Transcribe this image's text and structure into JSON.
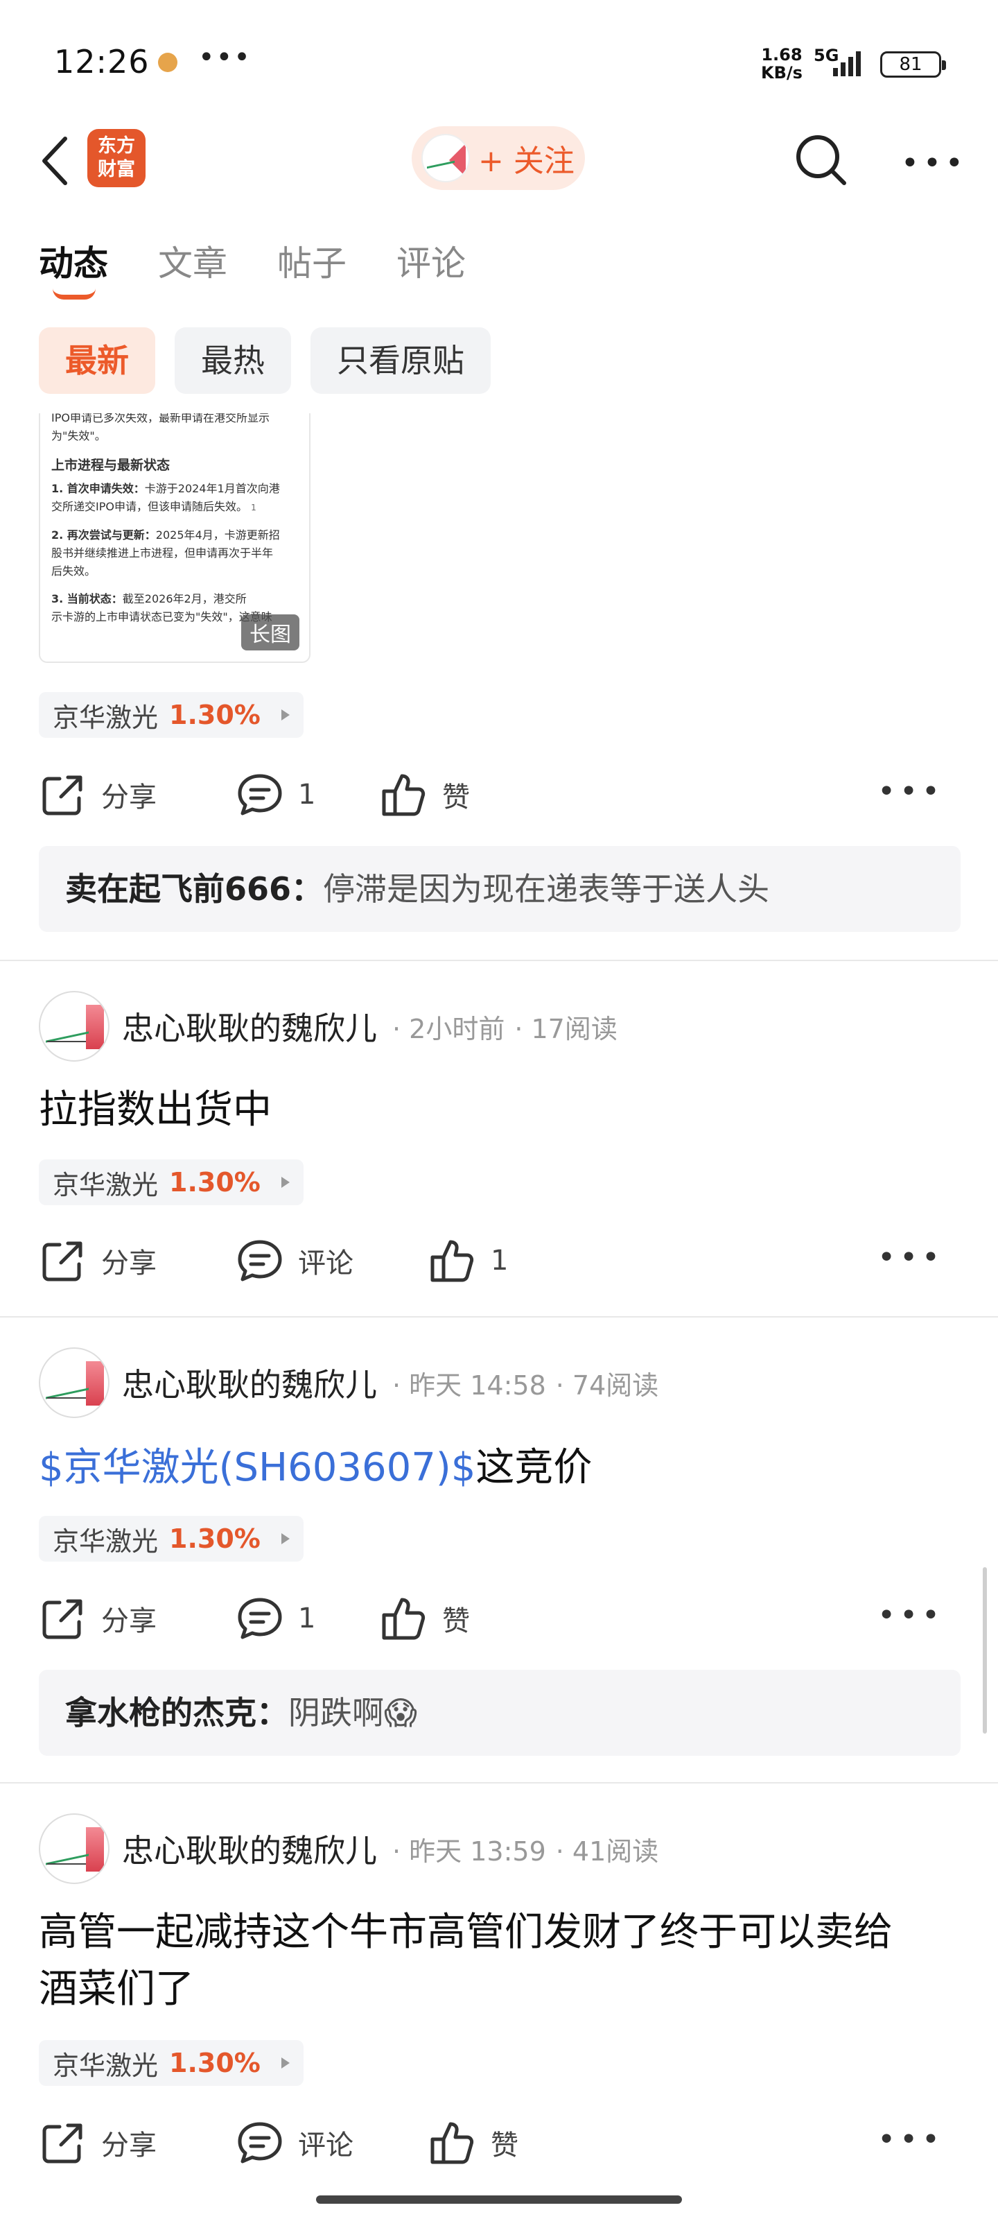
{
  "status_bar": {
    "time": "12:26",
    "speed_value": "1.68",
    "speed_unit": "KB/s",
    "network": "5G",
    "battery": "81"
  },
  "nav": {
    "logo_line1": "东方",
    "logo_line2": "财富",
    "follow_label": "+ 关注"
  },
  "tabs": [
    {
      "label": "动态",
      "active": true
    },
    {
      "label": "文章",
      "active": false
    },
    {
      "label": "帖子",
      "active": false
    },
    {
      "label": "评论",
      "active": false
    }
  ],
  "filters": [
    {
      "label": "最新",
      "active": true
    },
    {
      "label": "最热",
      "active": false
    },
    {
      "label": "只看原贴",
      "active": false
    }
  ],
  "first_post": {
    "long_image": {
      "lines": {
        "l1": "IPO申请已多次失效，最新申请在港交所显示",
        "l2": "为\"失效\"。",
        "h1": "上市进程与最新状态",
        "p1a_bold": "1. 首次申请失效：",
        "p1a": "卡游于2024年1月首次向港",
        "p1b": "交所递交IPO申请，但该申请随后失效。",
        "p1c": "1",
        "p2a_bold": "2. 再次尝试与更新：",
        "p2a": "2025年4月，卡游更新招",
        "p2b": "股书并继续推进上市进程，但申请再次于半年",
        "p2c": "后失效。",
        "p3a_bold": "3. 当前状态：",
        "p3a": "截至2026年2月，港交所",
        "p3b": "示卡游的上市申请状态已变为\"失效\"，这意味"
      },
      "badge": "长图"
    },
    "stock": {
      "name": "京华激光",
      "change": "1.30%"
    },
    "share": "分享",
    "comments": "1",
    "likes": "赞",
    "comment_preview": {
      "user": "卖在起飞前666：",
      "text": "停滞是因为现在递表等于送人头"
    }
  },
  "posts": [
    {
      "user": "忠心耿耿的魏欣儿",
      "time": "· 2小时前",
      "reads": "· 17阅读",
      "text": "拉指数出货中",
      "stock": {
        "name": "京华激光",
        "change": "1.30%"
      },
      "share": "分享",
      "comments": "评论",
      "likes": "1"
    },
    {
      "user": "忠心耿耿的魏欣儿",
      "time": "· 昨天 14:58",
      "reads": "· 74阅读",
      "link": "$京华激光(SH603607)$",
      "text": "这竞价",
      "stock": {
        "name": "京华激光",
        "change": "1.30%"
      },
      "share": "分享",
      "comments": "1",
      "likes": "赞",
      "comment_preview": {
        "user": "拿水枪的杰克：",
        "text": "阴跌啊😱"
      }
    },
    {
      "user": "忠心耿耿的魏欣儿",
      "time": "· 昨天 13:59",
      "reads": "· 41阅读",
      "text_line1": "高管一起减持这个牛市高管们发财了终于可以卖给",
      "text_line2": "酒菜们了",
      "stock": {
        "name": "京华激光",
        "change": "1.30%"
      },
      "share": "分享",
      "comments": "评论",
      "likes": "赞"
    }
  ],
  "icons": {
    "back": "back-arrow-icon",
    "search": "search-icon",
    "more": "more-dots-icon",
    "share": "share-icon",
    "comment": "comment-icon",
    "like": "thumbs-up-icon"
  },
  "colors": {
    "accent": "#ec5a2a",
    "link": "#3a6fd8",
    "stock_up": "#e4572b"
  }
}
